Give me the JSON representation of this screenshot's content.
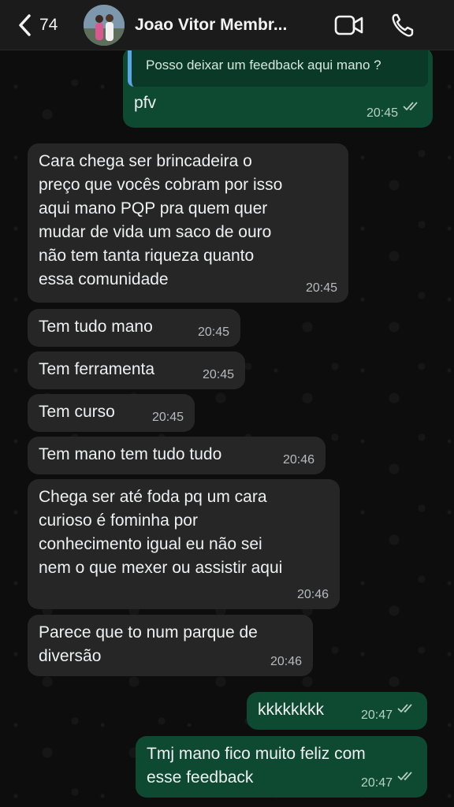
{
  "header": {
    "back_count": "74",
    "contact_name": "Joao Vitor Membr...",
    "icons": [
      "chevron-left-icon",
      "video-call-icon",
      "phone-icon"
    ]
  },
  "colors": {
    "incoming_bubble": "#262626",
    "outgoing_bubble": "#0e4a32",
    "quote_bar": "#5aa7e6",
    "header": "#1b1b1b"
  },
  "messages": [
    {
      "dir": "out",
      "quote": "Posso deixar um feedback aqui mano ?",
      "lines": [
        "pfv"
      ],
      "time": "20:45",
      "read": true
    },
    {
      "dir": "in",
      "lines": [
        "Cara chega ser brincadeira o",
        "preço que vocês cobram por isso",
        "aqui mano PQP pra quem quer",
        "mudar de vida um saco de ouro",
        "não tem tanta riqueza quanto",
        "essa comunidade"
      ],
      "time": "20:45"
    },
    {
      "dir": "in",
      "lines": [
        "Tem tudo mano"
      ],
      "time": "20:45"
    },
    {
      "dir": "in",
      "lines": [
        "Tem ferramenta"
      ],
      "time": "20:45"
    },
    {
      "dir": "in",
      "lines": [
        "Tem curso"
      ],
      "time": "20:45"
    },
    {
      "dir": "in",
      "lines": [
        "Tem mano tem tudo tudo"
      ],
      "time": "20:46"
    },
    {
      "dir": "in",
      "lines": [
        "Chega ser até foda pq um cara",
        "curioso é fominha por",
        "conhecimento igual eu não sei",
        "nem o que mexer ou assistir aqui"
      ],
      "time": "20:46"
    },
    {
      "dir": "in",
      "lines": [
        "Parece que to num parque de",
        "diversão"
      ],
      "time": "20:46"
    },
    {
      "dir": "out",
      "lines": [
        "kkkkkkkk"
      ],
      "time": "20:47",
      "read": true
    },
    {
      "dir": "out",
      "lines": [
        "Tmj mano fico muito feliz com",
        "esse feedback"
      ],
      "time": "20:47",
      "read": true
    }
  ]
}
